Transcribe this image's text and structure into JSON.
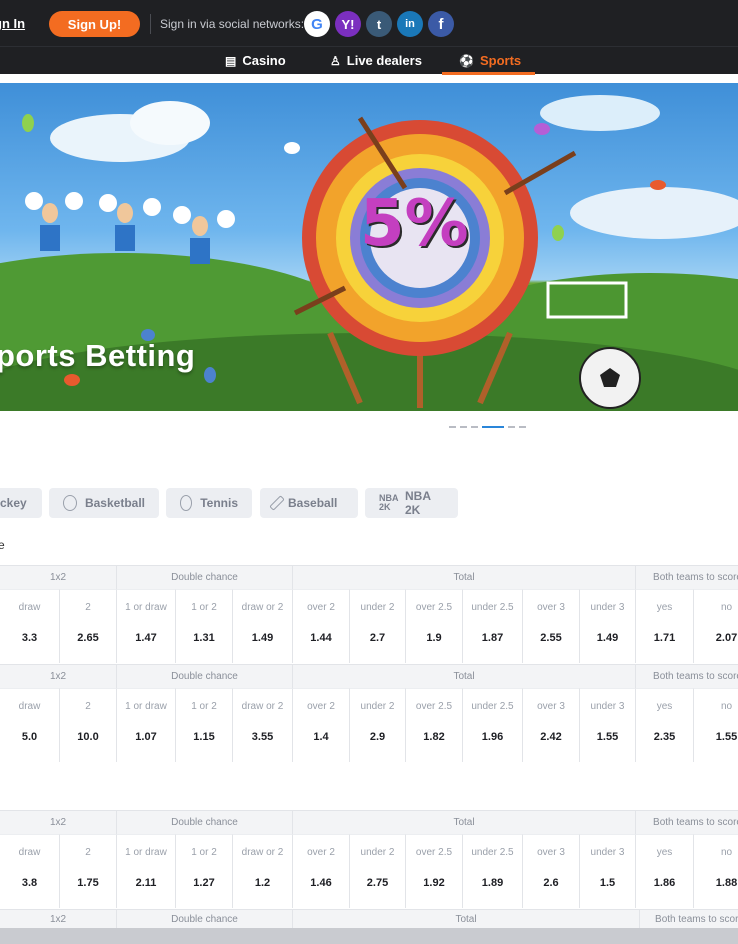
{
  "header": {
    "signin_label": "gn In",
    "signup_label": "Sign Up!",
    "social_label": "Sign in via social networks:",
    "social_icons": [
      "google-icon",
      "yahoo-icon",
      "tumblr-icon",
      "linkedin-icon",
      "facebook-icon"
    ],
    "social_glyphs": {
      "google": "G",
      "yahoo": "Y!",
      "tumblr": "t",
      "linkedin": "in",
      "facebook": "f"
    }
  },
  "nav": {
    "casino": "Casino",
    "live": "Live dealers",
    "sports": "Sports"
  },
  "banner": {
    "title": "ports Betting",
    "badge": "5%"
  },
  "chips": {
    "hockey": "ckey",
    "basketball": "Basketball",
    "tennis": "Tennis",
    "baseball": "Baseball",
    "nba": "NBA 2K",
    "nba_logo": "NBA 2K"
  },
  "section_label": "e",
  "groups": {
    "g1x2": "1x2",
    "double": "Double chance",
    "total": "Total",
    "btts": "Both teams to score"
  },
  "labels": {
    "draw": "draw",
    "two": "2",
    "one_or_draw": "1 or draw",
    "one_or_two": "1 or 2",
    "draw_or_two": "draw or 2",
    "over2": "over 2",
    "under2": "under 2",
    "over25": "over 2.5",
    "under25": "under 2.5",
    "over3": "over 3",
    "under3": "under 3",
    "yes": "yes",
    "no": "no"
  },
  "tables": [
    {
      "values": [
        "3.3",
        "2.65",
        "1.47",
        "1.31",
        "1.49",
        "1.44",
        "2.7",
        "1.9",
        "1.87",
        "2.55",
        "1.49",
        "1.71",
        "2.07"
      ]
    },
    {
      "values": [
        "5.0",
        "10.0",
        "1.07",
        "1.15",
        "3.55",
        "1.4",
        "2.9",
        "1.82",
        "1.96",
        "2.42",
        "1.55",
        "2.35",
        "1.55"
      ]
    },
    {
      "values": [
        "3.8",
        "1.75",
        "2.11",
        "1.27",
        "1.2",
        "1.46",
        "2.75",
        "1.92",
        "1.89",
        "2.6",
        "1.5",
        "1.86",
        "1.88"
      ]
    }
  ],
  "colors": {
    "accent": "#f36c21",
    "topbar": "#1f2023",
    "active_dot": "#2a86d9"
  }
}
